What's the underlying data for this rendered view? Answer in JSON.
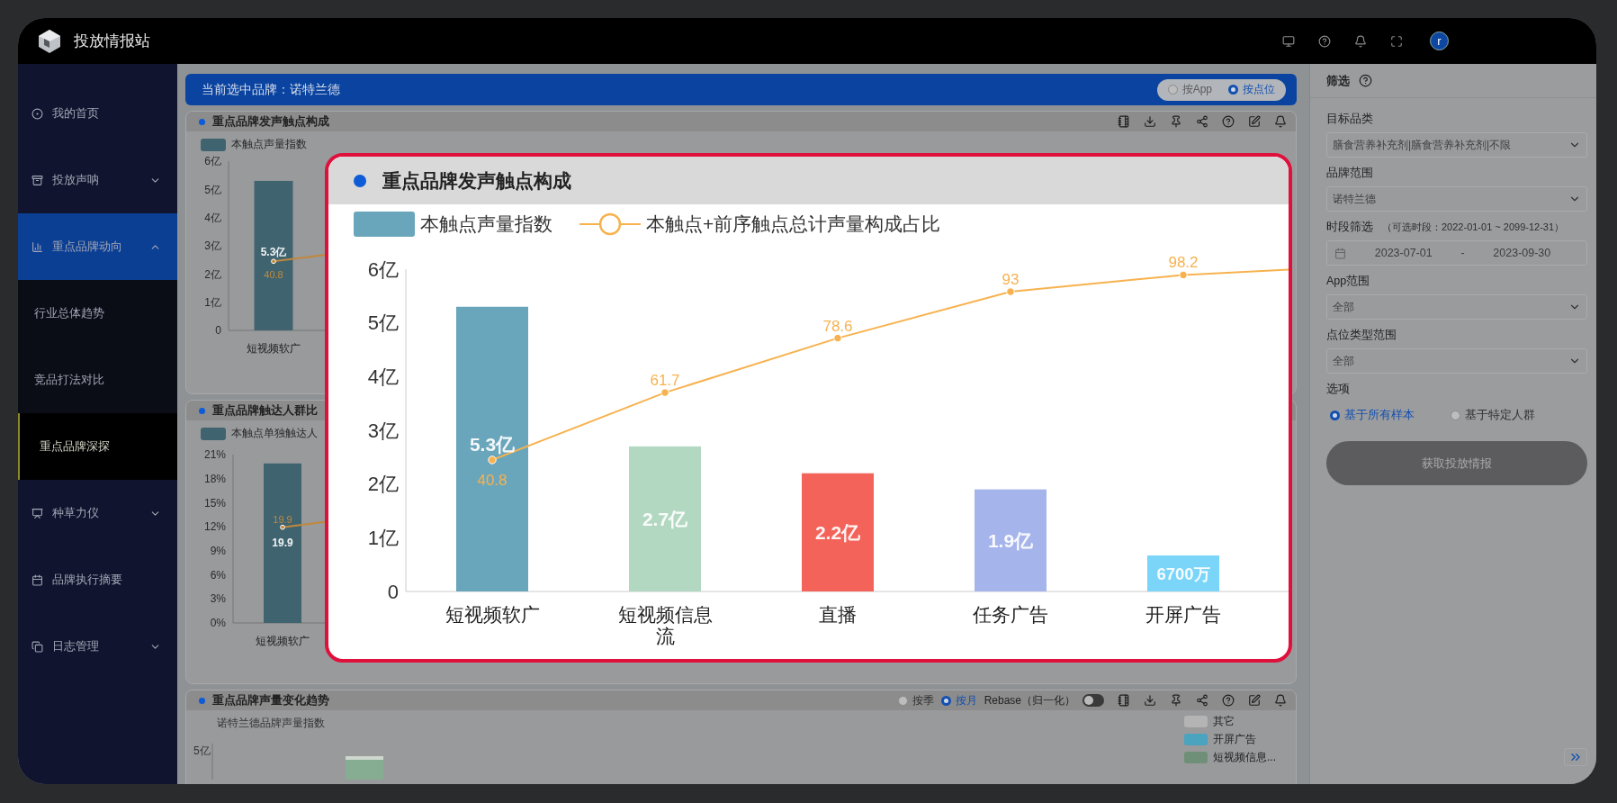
{
  "topbar": {
    "title": "投放情报站",
    "avatar": "r"
  },
  "sidebar": {
    "items": [
      {
        "label": "我的首页",
        "expandable": false,
        "selected": false
      },
      {
        "label": "投放声呐",
        "expandable": true,
        "expanded": false,
        "selected": false
      },
      {
        "label": "重点品牌动向",
        "expandable": true,
        "expanded": true,
        "selected": true,
        "children": [
          {
            "label": "行业总体趋势",
            "selected": false
          },
          {
            "label": "竞品打法对比",
            "selected": false
          },
          {
            "label": "重点品牌深探",
            "selected": true
          }
        ]
      },
      {
        "label": "种草力仪",
        "expandable": true,
        "expanded": false,
        "selected": false
      },
      {
        "label": "品牌执行摘要",
        "expandable": false,
        "selected": false
      },
      {
        "label": "日志管理",
        "expandable": true,
        "expanded": false,
        "selected": false
      }
    ]
  },
  "banner": {
    "text": "当前选中品牌：诺特兰德",
    "options": [
      {
        "label": "按App",
        "selected": false
      },
      {
        "label": "按点位",
        "selected": true
      }
    ]
  },
  "cards": [
    {
      "kind": "chart",
      "title": "重点品牌发声触点构成",
      "bars": {
        "chart_data": {
          "type": "bar",
          "categories": [
            "短视频软广"
          ],
          "ylim": [
            0,
            6
          ],
          "yticks": [
            {
              "value": 0,
              "label": "0"
            },
            {
              "value": 1,
              "label": "1亿"
            },
            {
              "value": 2,
              "label": "2亿"
            },
            {
              "value": 3,
              "label": "3亿"
            },
            {
              "value": 4,
              "label": "4亿"
            },
            {
              "value": 5,
              "label": "5亿"
            },
            {
              "value": 6,
              "label": "6亿"
            }
          ],
          "value_labels": [
            "5.3亿"
          ],
          "series": [
            {
              "name": "本触点声量指数",
              "color": "#3f6470",
              "values": [
                5.3
              ]
            }
          ]
        }
      },
      "line": {
        "color": "#c0883c",
        "point_labels": [
          "40.8"
        ]
      }
    },
    {
      "kind": "chart",
      "title": "重点品牌触达人群比",
      "bars": {
        "chart_data": {
          "type": "bar",
          "categories": [
            "短视频软广"
          ],
          "ylim": [
            0,
            21
          ],
          "yticks": [
            {
              "value": 0,
              "label": "0%"
            },
            {
              "value": 3,
              "label": "3%"
            },
            {
              "value": 6,
              "label": "6%"
            },
            {
              "value": 9,
              "label": "9%"
            },
            {
              "value": 12,
              "label": "12%"
            },
            {
              "value": 15,
              "label": "15%"
            },
            {
              "value": 18,
              "label": "18%"
            },
            {
              "value": 21,
              "label": "21%"
            }
          ],
          "value_labels": [
            "19.9"
          ],
          "series": [
            {
              "name": "本触点单独触达人",
              "color": "#3f6470",
              "values": [
                19.9
              ]
            }
          ]
        }
      },
      "line": {
        "color": "#c0883c",
        "point_labels": [
          "19.9"
        ]
      }
    },
    {
      "kind": "trend",
      "title": "重点品牌声量变化趋势",
      "period_options": [
        {
          "label": "按季",
          "selected": false
        },
        {
          "label": "按月",
          "selected": true
        }
      ],
      "rebase": {
        "label": "Rebase（归一化）",
        "on": false
      },
      "subtitle": "诺特兰德品牌声量指数",
      "y_tick": "5亿",
      "legend": [
        {
          "label": "其它",
          "color": "#b4b4b4"
        },
        {
          "label": "开屏广告",
          "color": "#4aa3bf"
        },
        {
          "label": "短视频信息...",
          "color": "#6f8f78"
        }
      ]
    }
  ],
  "popup": {
    "title": "重点品牌发声触点构成",
    "bars": {
      "chart_data": {
        "type": "bar",
        "categories": [
          "短视频软广",
          "短视频信息流",
          "直播",
          "任务广告",
          "开屏广告"
        ],
        "ylim": [
          0,
          6
        ],
        "yticks": [
          {
            "value": 0,
            "label": "0"
          },
          {
            "value": 1,
            "label": "1亿"
          },
          {
            "value": 2,
            "label": "2亿"
          },
          {
            "value": 3,
            "label": "3亿"
          },
          {
            "value": 4,
            "label": "4亿"
          },
          {
            "value": 5,
            "label": "5亿"
          },
          {
            "value": 6,
            "label": "6亿"
          }
        ],
        "value_labels": [
          "5.3亿",
          "2.7亿",
          "2.2亿",
          "1.9亿",
          "6700万"
        ],
        "series": [
          {
            "name": "本触点声量指数",
            "color": "#6aa6bb",
            "colors": [
              "#6aa6bb",
              "#b2d8c1",
              "#f4635a",
              "#a5b4ea",
              "#7ad5f8"
            ],
            "values": [
              5.3,
              2.7,
              2.2,
              1.9,
              0.67
            ]
          }
        ]
      }
    },
    "line": {
      "name": "本触点+前序触点总计声量构成占比",
      "color": "#f7b24f",
      "point_labels": [
        "40.8",
        "61.7",
        "78.6",
        "93",
        "98.2"
      ]
    }
  },
  "filters": {
    "title": "筛选",
    "fields": [
      {
        "kind": "select",
        "label": "目标品类",
        "value": "膳食营养补充剂|膳食营养补充剂|不限"
      },
      {
        "kind": "select",
        "label": "品牌范围",
        "value": "诺特兰德"
      },
      {
        "kind": "date",
        "label": "时段筛选",
        "hint": "（可选时段：2022-01-01 ~ 2099-12-31）",
        "start": "2023-07-01",
        "separator": "-",
        "end": "2023-09-30"
      },
      {
        "kind": "select",
        "label": "App范围",
        "value": "全部"
      },
      {
        "kind": "select",
        "label": "点位类型范围",
        "value": "全部"
      },
      {
        "kind": "radio",
        "label": "选项",
        "options": [
          {
            "label": "基于所有样本",
            "selected": true
          },
          {
            "label": "基于特定人群",
            "selected": false
          }
        ]
      }
    ],
    "submit": "获取投放情报"
  }
}
